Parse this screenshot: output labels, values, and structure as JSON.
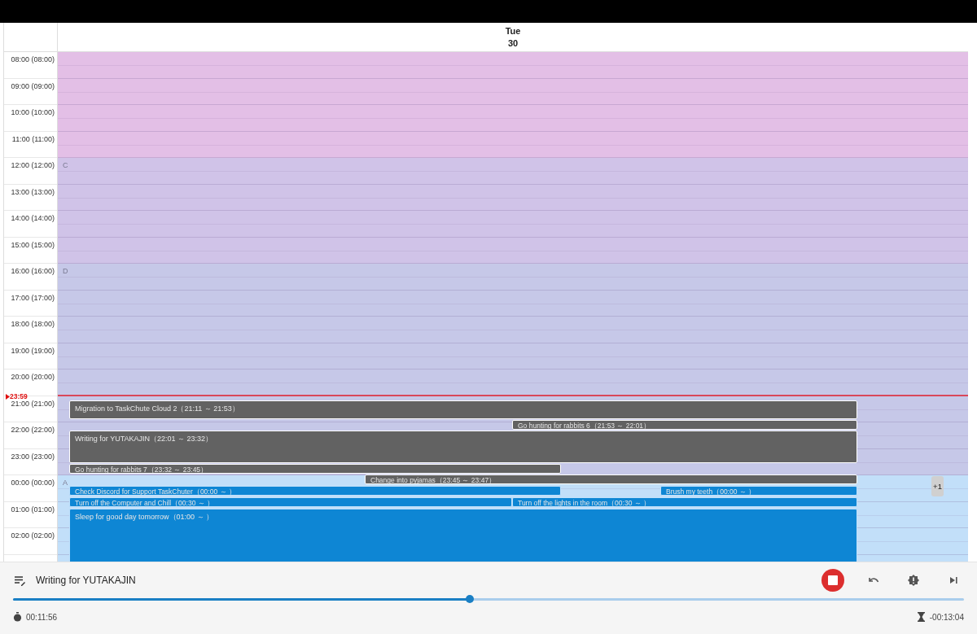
{
  "day_header": {
    "weekday": "Tue",
    "date": "30"
  },
  "sections": [
    {
      "color": "#e3bfe6",
      "hours": [
        "08:00 (08:00)",
        "09:00 (09:00)",
        "10:00 (10:00)",
        "11:00 (11:00)"
      ]
    },
    {
      "letter": "C",
      "color": "#d0c3e8",
      "hours": [
        "12:00 (12:00)",
        "13:00 (13:00)",
        "14:00 (14:00)",
        "15:00 (15:00)"
      ]
    },
    {
      "letter": "D",
      "color": "#c6c8e8",
      "hours": [
        "16:00 (16:00)",
        "17:00 (17:00)",
        "18:00 (18:00)",
        "19:00 (19:00)",
        "20:00 (20:00)",
        "21:00 (21:00)",
        "22:00 (22:00)",
        "23:00 (23:00)"
      ]
    },
    {
      "letter": "A",
      "color": "#c2dff9",
      "hours": [
        "00:00 (00:00)",
        "01:00 (01:00)",
        "02:00 (02:00)"
      ]
    }
  ],
  "current_time": "23:59",
  "events": [
    {
      "title": "Migration to TaskChute Cloud 2（21:11 ～ 21:53）",
      "kind": "done"
    },
    {
      "title": "Go hunting for rabbits 6（21:53 ～ 22:01）",
      "kind": "done"
    },
    {
      "title": "Writing for YUTAKAJIN（22:01 ～ 23:32）",
      "kind": "done"
    },
    {
      "title": "Go hunting for rabbits 7（23:32 ～ 23:45）",
      "kind": "done"
    },
    {
      "title": "Change into pyjamas（23:45 ～ 23:47）",
      "kind": "done"
    },
    {
      "title": "Check Discord for Support TaskChuter（00:00 ～ ）",
      "kind": "planned"
    },
    {
      "title": "Brush my teeth（00:00 ～ ）",
      "kind": "planned"
    },
    {
      "title": "Turn off the Computer and Chill（00:30 ～ ）",
      "kind": "planned"
    },
    {
      "title": "Turn off the lights in the room（00:30 ～ ）",
      "kind": "planned"
    },
    {
      "title": "Sleep for good day tomorrow（01:00 ～ ）",
      "kind": "planned"
    }
  ],
  "more_badge": "+1",
  "player": {
    "task": "Writing for YUTAKAJIN",
    "running": true,
    "level": 0.48,
    "elapsed": "00:11:56",
    "remaining": "-00:13:04"
  }
}
